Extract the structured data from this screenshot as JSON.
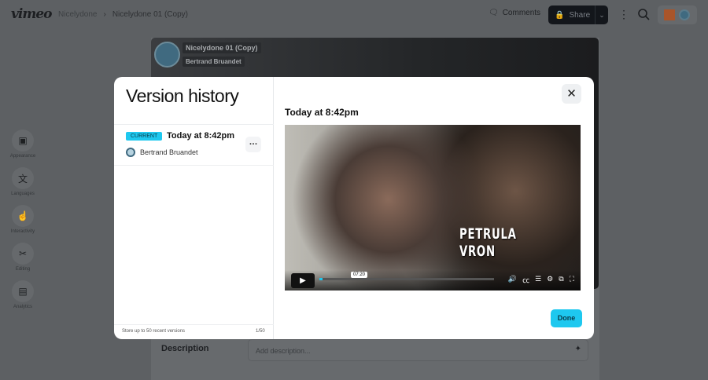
{
  "topbar": {
    "logo": "vimeo",
    "breadcrumb": [
      "Nicelydone",
      "Nicelydone 01 (Copy)"
    ],
    "comments": "Comments",
    "share": "Share"
  },
  "sidebar": [
    {
      "label": "Appearance",
      "icon": "play-square-icon"
    },
    {
      "label": "Languages",
      "icon": "translate-icon"
    },
    {
      "label": "Interactivity",
      "icon": "tap-icon"
    },
    {
      "label": "Editing",
      "icon": "scissors-icon"
    },
    {
      "label": "Analytics",
      "icon": "chart-icon"
    }
  ],
  "background": {
    "video_title": "Nicelydone 01 (Copy)",
    "video_author": "Bertrand Bruandet",
    "description_label": "Description",
    "description_placeholder": "Add description..."
  },
  "modal": {
    "title": "Version history",
    "versions": [
      {
        "badge": "CURRENT",
        "time": "Today at 8:42pm",
        "author": "Bertrand Bruandet"
      }
    ],
    "footer": "Store up to 50 recent versions",
    "count": "1/50",
    "preview_title": "Today at 8:42pm",
    "video_overlay_text": "PETRULA VRON",
    "tooltip_time": "07:20",
    "progress": 0.02,
    "done": "Done"
  },
  "colors": {
    "accent": "#1ec8ef"
  }
}
